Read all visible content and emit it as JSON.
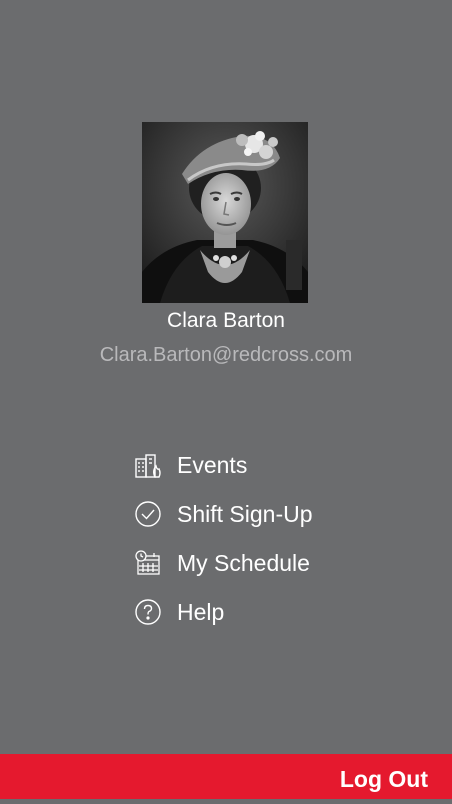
{
  "profile": {
    "name": "Clara Barton",
    "email": "Clara.Barton@redcross.com",
    "photo_icon": "portrait-photo"
  },
  "menu": {
    "items": [
      {
        "label": "Events",
        "icon": "events-icon"
      },
      {
        "label": "Shift Sign-Up",
        "icon": "check-circle-icon"
      },
      {
        "label": "My Schedule",
        "icon": "calendar-clock-icon"
      },
      {
        "label": "Help",
        "icon": "help-circle-icon"
      }
    ]
  },
  "footer": {
    "logout_label": "Log Out"
  },
  "colors": {
    "background": "#6b6c6e",
    "accent": "#e5192e",
    "email_text": "#b9b9bb"
  }
}
